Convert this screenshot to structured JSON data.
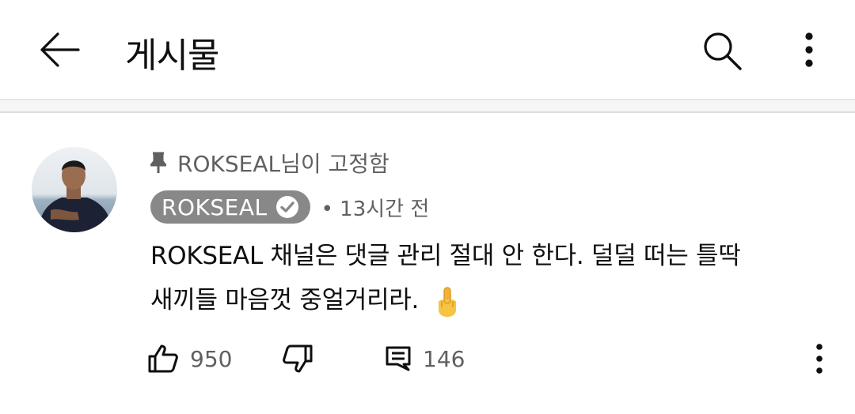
{
  "header": {
    "title": "게시물",
    "back_icon": "back-arrow-icon",
    "search_icon": "search-icon",
    "more_icon": "more-vertical-icon"
  },
  "comment": {
    "pinned_text": "ROKSEAL님이 고정함",
    "pin_icon": "pin-icon",
    "author": "ROKSEAL",
    "verified_icon": "verified-check-icon",
    "meta": "• 13시간 전",
    "text_line1": "ROKSEAL 채널은 댓글 관리 절대 안 한다. 덜덜 떠는 틀딱",
    "text_line2": "새끼들 마음껏 중얼거리라.",
    "emoji_icon": "middle-finger-emoji-icon",
    "likes": "950",
    "replies": "146",
    "like_icon": "thumbs-up-icon",
    "dislike_icon": "thumbs-down-icon",
    "reply_icon": "comment-reply-icon",
    "more_icon": "more-vertical-icon"
  },
  "colors": {
    "chip_bg": "#888888",
    "secondary_text": "#606060",
    "primary_text": "#0f0f0f"
  }
}
